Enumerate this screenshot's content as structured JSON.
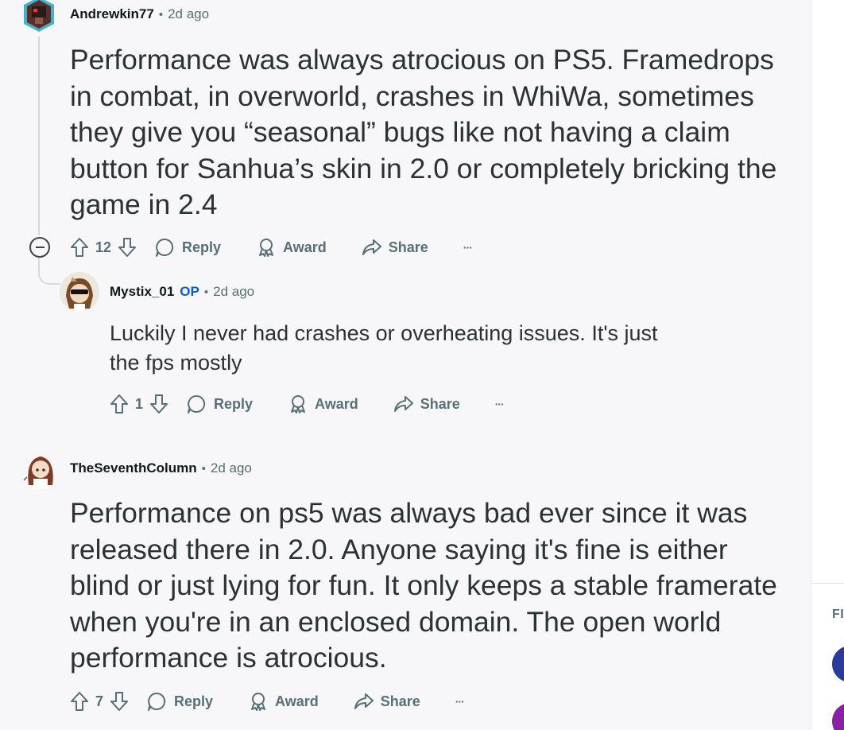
{
  "comments": [
    {
      "username": "Andrewkin77",
      "time": "2d ago",
      "body": "Performance was always atrocious on PS5. Framedrops in combat, in overworld, crashes in WhiWa, sometimes they give you “seasonal” bugs like not having a claim button for Sanhua’s skin in 2.0 or completely bricking the game in 2.4",
      "votes": "12",
      "reply_label": "Reply",
      "award_label": "Award",
      "share_label": "Share",
      "more_label": "···"
    },
    {
      "username": "Mystix_01",
      "op_badge": "OP",
      "time": "2d ago",
      "body": "Luckily I never had crashes or overheating issues. It's just the fps mostly",
      "votes": "1",
      "reply_label": "Reply",
      "award_label": "Award",
      "share_label": "Share",
      "more_label": "···"
    },
    {
      "username": "TheSeventhColumn",
      "time": "2d ago",
      "body": "Performance on ps5 was always bad ever since it was released there in 2.0. Anyone saying it's fine is either blind or just lying for fun. It only keeps a stable framerate when you're in an enclosed domain. The open world performance is atrocious.",
      "votes": "7",
      "reply_label": "Reply",
      "award_label": "Award",
      "share_label": "Share",
      "more_label": "···"
    }
  ],
  "separator": "•",
  "right_rail": {
    "label": "FI"
  },
  "colors": {
    "accent_op": "#0a5bd3",
    "meta": "#576f76",
    "text": "#2a3236"
  }
}
